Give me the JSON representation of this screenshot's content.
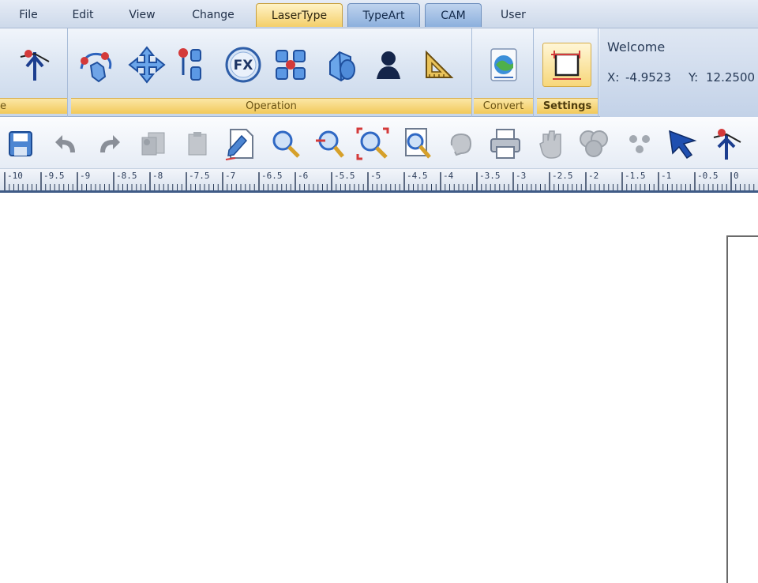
{
  "menu": {
    "tabs": [
      {
        "label": "File"
      },
      {
        "label": "Edit"
      },
      {
        "label": "View"
      },
      {
        "label": "Change"
      },
      {
        "label": "LaserType"
      },
      {
        "label": "TypeArt"
      },
      {
        "label": "CAM"
      },
      {
        "label": "User"
      }
    ],
    "active_tab": "LaserType"
  },
  "ribbon": {
    "groups": [
      {
        "label": "e"
      },
      {
        "label": "Operation"
      },
      {
        "label": "Convert"
      },
      {
        "label": "Settings"
      }
    ],
    "buttons": {
      "anchor": "anchor-pin-icon",
      "node_edit": "node-hand-icon",
      "move": "move-arrows-icon",
      "align_nodes": "align-nodes-icon",
      "fx": "FX",
      "arrange": "arrange-shapes-icon",
      "shapes3d": "3d-shapes-icon",
      "user_shape": "user-silhouette-icon",
      "measure": "triangle-ruler-icon",
      "convert": "convert-globe-icon",
      "settings": "page-settings-icon"
    }
  },
  "info": {
    "welcome": "Welcome",
    "x_label": "X:",
    "x_value": "-4.9523",
    "y_label": "Y:",
    "y_value": "12.2500"
  },
  "toolbar": {
    "items": [
      "save",
      "undo",
      "redo",
      "copy",
      "paste",
      "document",
      "zoom-in",
      "zoom-out",
      "zoom-fit",
      "zoom-page",
      "lasso",
      "print",
      "hand",
      "group",
      "dots",
      "select-arrow",
      "anchor-pin"
    ]
  },
  "ruler": {
    "labels": [
      "-10",
      "-9.5",
      "-9",
      "-8.5",
      "-8",
      "-7.5",
      "-7",
      "-6.5",
      "-6",
      "-5.5",
      "-5",
      "-4.5",
      "-4",
      "-3.5",
      "-3",
      "-2.5",
      "-2",
      "-1.5",
      "-1",
      "-0.5",
      "0"
    ]
  },
  "colors": {
    "accent": "#f2c95a",
    "ribbon_blue": "#c7d6ea",
    "icon_blue": "#2f68c4"
  }
}
